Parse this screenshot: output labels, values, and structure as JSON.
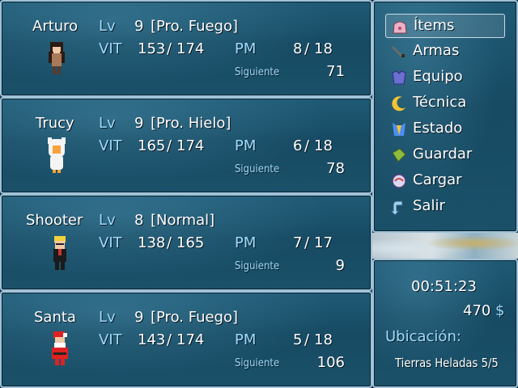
{
  "party": [
    {
      "name": "Arturo",
      "lv_label": "Lv",
      "level": "9",
      "class": "[Pro. Fuego]",
      "vit_label": "VIT",
      "vit_cur": "153",
      "vit_max": "174",
      "pm_label": "PM",
      "pm_cur": "8",
      "pm_max": "18",
      "next_label": "Siguiente",
      "next_value": "71",
      "sprite": "dark-haired-character"
    },
    {
      "name": "Trucy",
      "lv_label": "Lv",
      "level": "9",
      "class": "[Pro. Hielo]",
      "vit_label": "VIT",
      "vit_cur": "165",
      "vit_max": "174",
      "pm_label": "PM",
      "pm_cur": "6",
      "pm_max": "18",
      "next_label": "Siguiente",
      "next_value": "78",
      "sprite": "white-hooded-character"
    },
    {
      "name": "Shooter",
      "lv_label": "Lv",
      "level": "8",
      "class": "[Normal]",
      "vit_label": "VIT",
      "vit_cur": "138",
      "vit_max": "165",
      "pm_label": "PM",
      "pm_cur": "7",
      "pm_max": "17",
      "next_label": "Siguiente",
      "next_value": "9",
      "sprite": "blonde-black-suit-character"
    },
    {
      "name": "Santa",
      "lv_label": "Lv",
      "level": "9",
      "class": "[Pro. Fuego]",
      "vit_label": "VIT",
      "vit_cur": "143",
      "vit_max": "174",
      "pm_label": "PM",
      "pm_cur": "5",
      "pm_max": "18",
      "next_label": "Siguiente",
      "next_value": "106",
      "sprite": "santa-character"
    }
  ],
  "menu": [
    {
      "label": "Ítems",
      "icon": "bag-icon"
    },
    {
      "label": "Armas",
      "icon": "sword-icon"
    },
    {
      "label": "Equipo",
      "icon": "armor-icon"
    },
    {
      "label": "Técnica",
      "icon": "moon-icon"
    },
    {
      "label": "Estado",
      "icon": "status-icon"
    },
    {
      "label": "Guardar",
      "icon": "book-icon"
    },
    {
      "label": "Cargar",
      "icon": "disk-icon"
    },
    {
      "label": "Salir",
      "icon": "exit-arrow-icon"
    }
  ],
  "info": {
    "playtime": "00:51:23",
    "gold": "470",
    "currency": "$",
    "location_label": "Ubicación:",
    "location": "Tierras Heladas 5/5"
  },
  "colors": {
    "system_text": "#9fdcff",
    "window_border": "#9fc3d8",
    "window_fill": "#1a5169"
  }
}
